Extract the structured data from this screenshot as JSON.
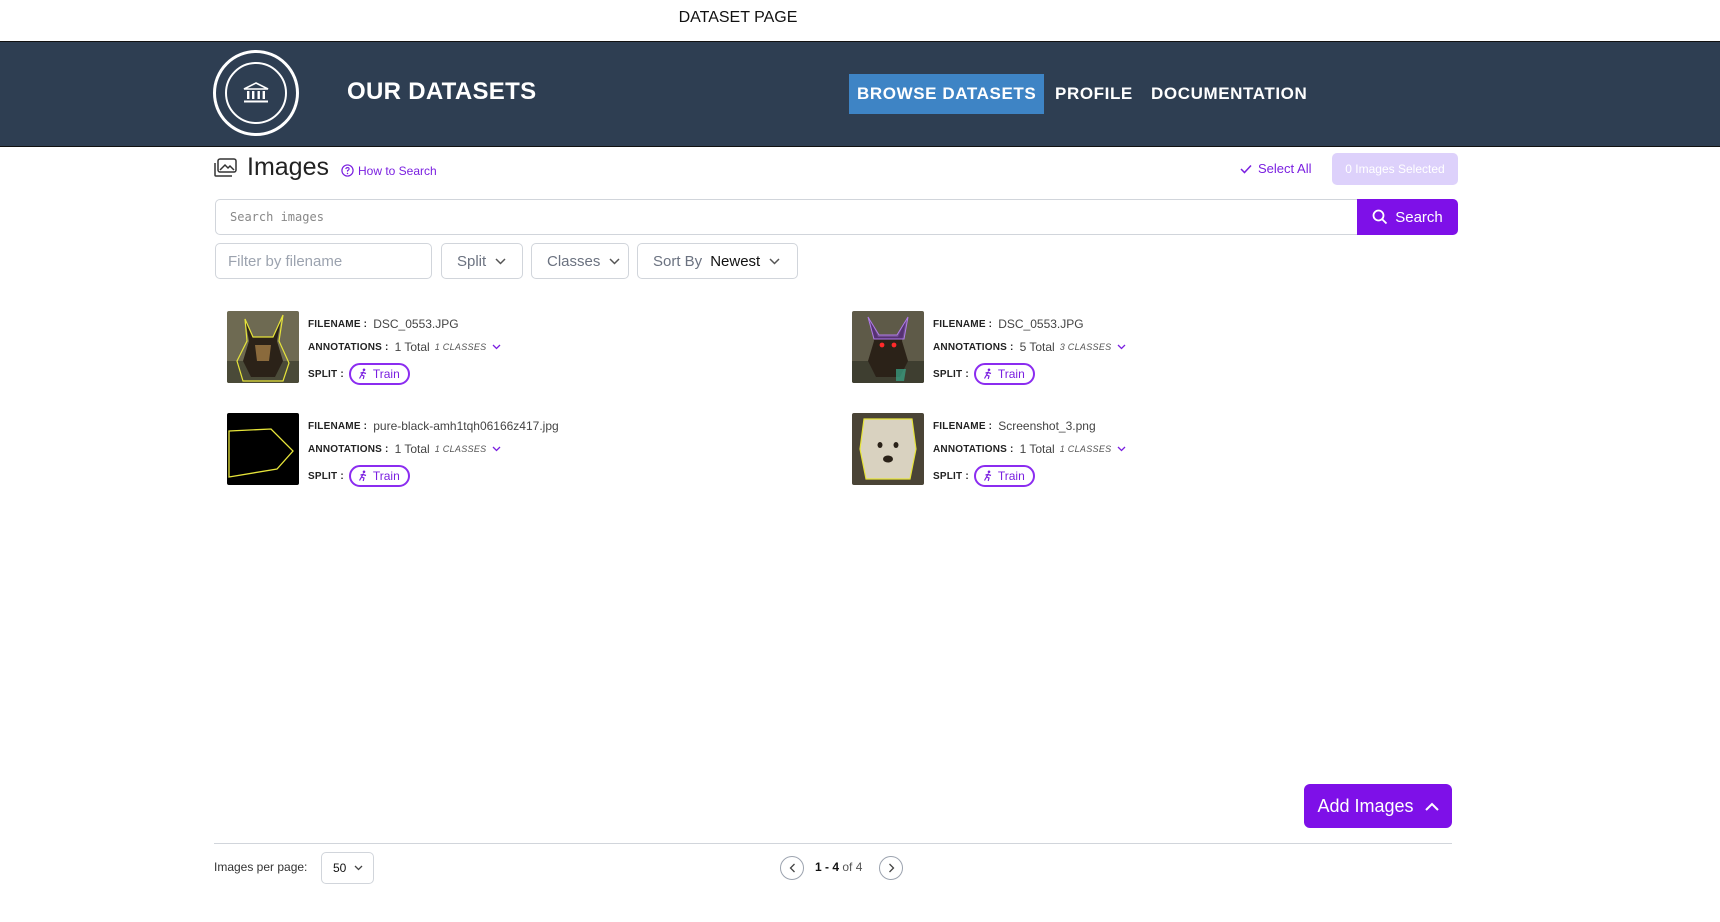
{
  "page_label": "DATASET PAGE",
  "header": {
    "brand": "OUR DATASETS",
    "nav": [
      {
        "label": "BROWSE DATASETS",
        "active": true
      },
      {
        "label": "PROFILE",
        "active": false
      },
      {
        "label": "DOCUMENTATION",
        "active": false
      }
    ]
  },
  "images_section": {
    "title": "Images",
    "how_to_search": "How to Search",
    "select_all": "Select All",
    "selected_badge": "0 Images Selected"
  },
  "search": {
    "placeholder": "Search images",
    "button_label": "Search"
  },
  "filters": {
    "filename_placeholder": "Filter by filename",
    "split_label": "Split",
    "classes_label": "Classes",
    "sort_label": "Sort By",
    "sort_value": "Newest"
  },
  "field_labels": {
    "filename": "FILENAME :",
    "annotations": "ANNOTATIONS :",
    "split": "SPLIT :"
  },
  "images": [
    {
      "filename": "DSC_0553.JPG",
      "annotations": "1 Total",
      "classes": "1 CLASSES",
      "split": "Train",
      "thumb": "dog-outline"
    },
    {
      "filename": "DSC_0553.JPG",
      "annotations": "5 Total",
      "classes": "3 CLASSES",
      "split": "Train",
      "thumb": "dog-multi"
    },
    {
      "filename": "pure-black-amh1tqh06166z417.jpg",
      "annotations": "1 Total",
      "classes": "1 CLASSES",
      "split": "Train",
      "thumb": "black-polygon"
    },
    {
      "filename": "Screenshot_3.png",
      "annotations": "1 Total",
      "classes": "1 CLASSES",
      "split": "Train",
      "thumb": "white-dog"
    }
  ],
  "add_images": {
    "label": "Add Images"
  },
  "pagination": {
    "per_page_label": "Images per page:",
    "per_page_value": "50",
    "range": "1 - 4",
    "of_label": "of",
    "total": "4"
  },
  "colors": {
    "header_bg": "#2e3e52",
    "nav_active": "#3e84c5",
    "accent": "#7e10e8",
    "badge_bg": "#ddd1fb"
  }
}
